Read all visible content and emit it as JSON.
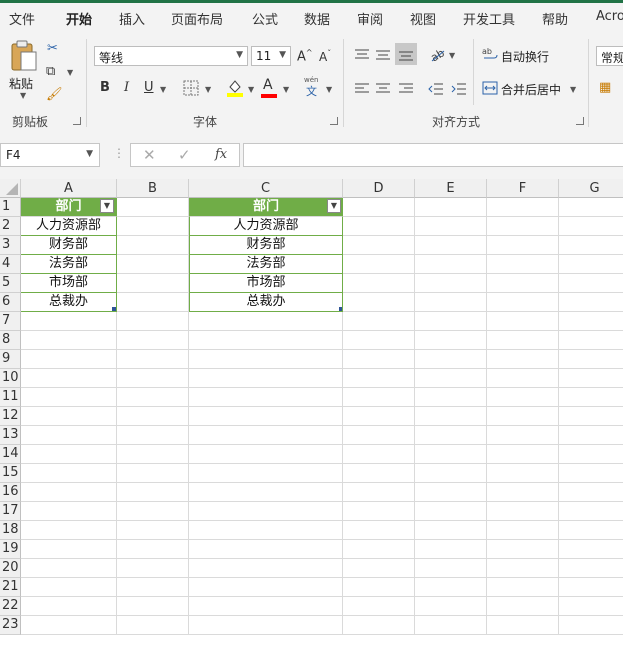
{
  "tabs": [
    "文件",
    "开始",
    "插入",
    "页面布局",
    "公式",
    "数据",
    "审阅",
    "视图",
    "开发工具",
    "帮助",
    "Acro"
  ],
  "active_tab": "开始",
  "ribbon": {
    "clipboard": {
      "paste_label": "粘贴",
      "group_label": "剪贴板"
    },
    "font": {
      "font_name": "等线",
      "font_size": "11",
      "bold": "B",
      "italic": "I",
      "underline": "U",
      "font_color_letter": "A",
      "grow": "A",
      "shrink": "A",
      "phonetic_top": "wén",
      "phonetic_bottom": "文",
      "group_label": "字体",
      "fill_color": "#ffff00",
      "font_color": "#ff0000"
    },
    "alignment": {
      "wrap_text": "自动换行",
      "merge_center": "合并后居中",
      "group_label": "对齐方式"
    },
    "number": {
      "format": "常规"
    }
  },
  "formula_bar": {
    "name_box": "F4",
    "fx": "fx",
    "formula": ""
  },
  "columns": [
    "A",
    "B",
    "C",
    "D",
    "E",
    "F",
    "G"
  ],
  "rows": [
    "1",
    "2",
    "3",
    "4",
    "5",
    "6",
    "7",
    "8",
    "9",
    "10",
    "11",
    "12",
    "13",
    "14",
    "15",
    "16",
    "17",
    "18",
    "19",
    "20",
    "21",
    "22",
    "23"
  ],
  "table_a": {
    "header": "部门",
    "values": [
      "人力资源部",
      "财务部",
      "法务部",
      "市场部",
      "总裁办"
    ]
  },
  "table_c": {
    "header": "部门",
    "values": [
      "人力资源部",
      "财务部",
      "法务部",
      "市场部",
      "总裁办"
    ]
  },
  "colors": {
    "excel_green": "#217346",
    "table_header": "#70ad47"
  }
}
